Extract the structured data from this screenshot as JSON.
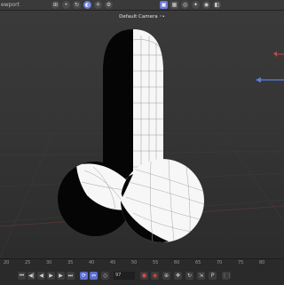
{
  "topbar": {
    "left_text": "ewport",
    "icons_left": [
      "grid-icon",
      "point-icon",
      "rotate-icon",
      "snap-icon",
      "axis-icon",
      "gear-icon"
    ],
    "icons_right": [
      "cube-icon",
      "display-icon",
      "render-icon",
      "light-icon",
      "visibility-icon",
      "camera-icon"
    ]
  },
  "viewport": {
    "camera_label": "Default Camera ◦•"
  },
  "timeline": {
    "ruler_labels": [
      "20",
      "25",
      "30",
      "35",
      "40",
      "45",
      "50",
      "55",
      "60",
      "65",
      "70",
      "75",
      "80"
    ],
    "frame_value": "97",
    "accent_color": "#5a6fcf",
    "record_color": "#e04444"
  }
}
